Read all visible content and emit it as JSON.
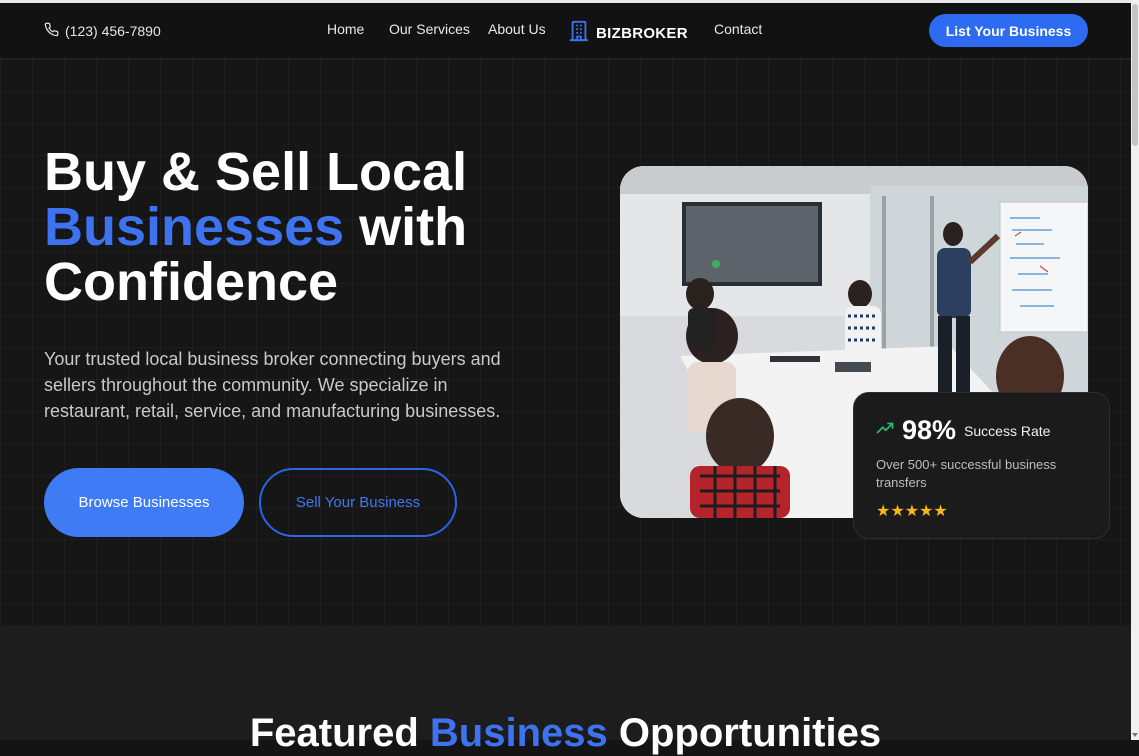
{
  "header": {
    "phone": "(123) 456-7890",
    "nav": [
      "Home",
      "Our Services",
      "About Us",
      "Contact"
    ],
    "logo_text": "BIZBROKER",
    "cta": "List Your Business"
  },
  "hero": {
    "title_line1": "Buy & Sell Local",
    "title_accent": "Businesses",
    "title_mid": " with",
    "title_line3": "Confidence",
    "description": "Your trusted local business broker connecting buyers and sellers throughout the community. We specialize in restaurant, retail, service, and manufacturing businesses.",
    "primary_button": "Browse Businesses",
    "secondary_button": "Sell Your Business"
  },
  "stats_card": {
    "percent": "98%",
    "label": "Success Rate",
    "description": "Over 500+ successful business transfers",
    "stars": "★★★★★",
    "rating": 5
  },
  "featured": {
    "title_pre": "Featured ",
    "title_accent": "Business",
    "title_post": " Opportunities"
  },
  "colors": {
    "accent": "#3d72f0",
    "button": "#2c6bf2",
    "star": "#f7b619",
    "trend": "#27c06a",
    "background": "#141414"
  },
  "icons": [
    "phone-icon",
    "building-logo-icon",
    "trend-up-icon",
    "star-icon"
  ]
}
